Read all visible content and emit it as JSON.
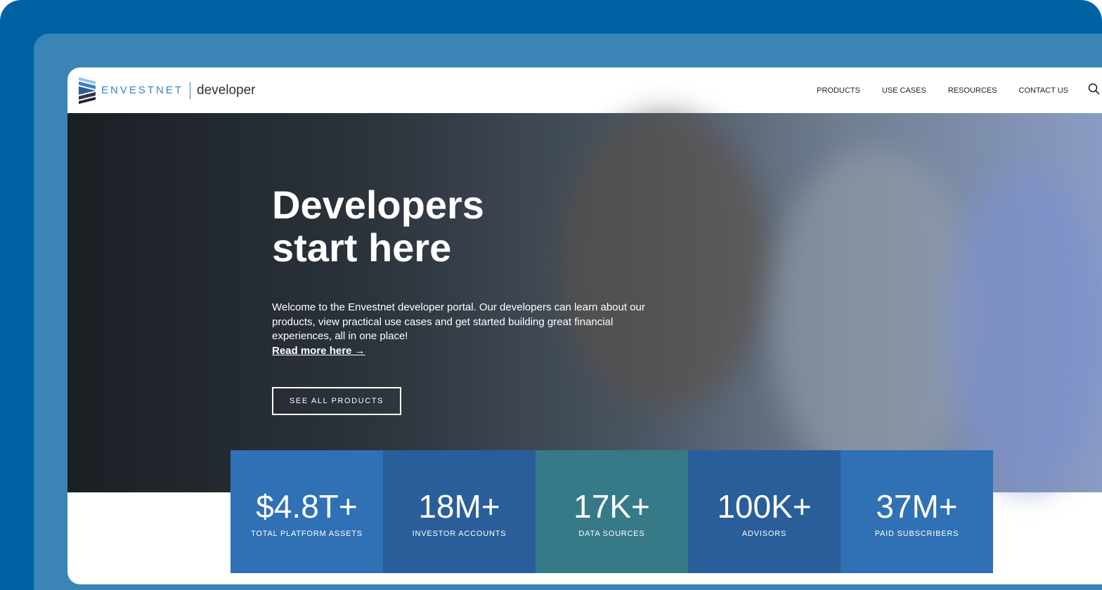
{
  "header": {
    "brand": "ENVESTNET",
    "product": "developer",
    "nav": [
      "PRODUCTS",
      "USE CASES",
      "RESOURCES",
      "CONTACT US"
    ],
    "search_icon": "search-icon"
  },
  "hero": {
    "title_line1": "Developers",
    "title_line2": "start here",
    "description": "Welcome to the Envestnet developer portal. Our developers can learn about our products, view practical use cases and get started building great financial experiences, all in one place!",
    "read_more": "Read more here →",
    "cta": "SEE ALL PRODUCTS"
  },
  "stats": [
    {
      "value": "$4.8T+",
      "label": "TOTAL PLATFORM ASSETS",
      "color": "#3070b5"
    },
    {
      "value": "18M+",
      "label": "INVESTOR ACCOUNTS",
      "color": "#2a5e9a"
    },
    {
      "value": "17K+",
      "label": "DATA SOURCES",
      "color": "#367a88"
    },
    {
      "value": "100K+",
      "label": "ADVISORS",
      "color": "#2a5e9a"
    },
    {
      "value": "37M+",
      "label": "PAID SUBSCRIBERS",
      "color": "#3070b5"
    }
  ]
}
